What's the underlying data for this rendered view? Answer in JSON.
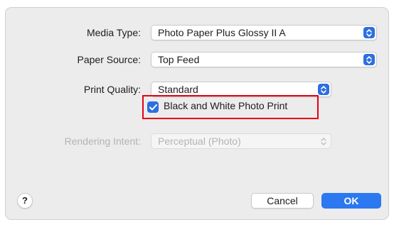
{
  "settings": {
    "media_type": {
      "label": "Media Type:",
      "value": "Photo Paper Plus Glossy II A"
    },
    "paper_source": {
      "label": "Paper Source:",
      "value": "Top Feed"
    },
    "print_quality": {
      "label": "Print Quality:",
      "value": "Standard"
    },
    "bw_photo": {
      "label": "Black and White Photo Print",
      "checked": true
    },
    "rendering_intent": {
      "label": "Rendering Intent:",
      "value": "Perceptual (Photo)",
      "enabled": false
    }
  },
  "footer": {
    "help_label": "?",
    "cancel_label": "Cancel",
    "ok_label": "OK"
  },
  "colors": {
    "accent": "#2d6fe0",
    "highlight_border": "#e60012"
  },
  "icons": {
    "popup": "chevron-up-down-icon",
    "checkbox": "checkmark-icon"
  }
}
